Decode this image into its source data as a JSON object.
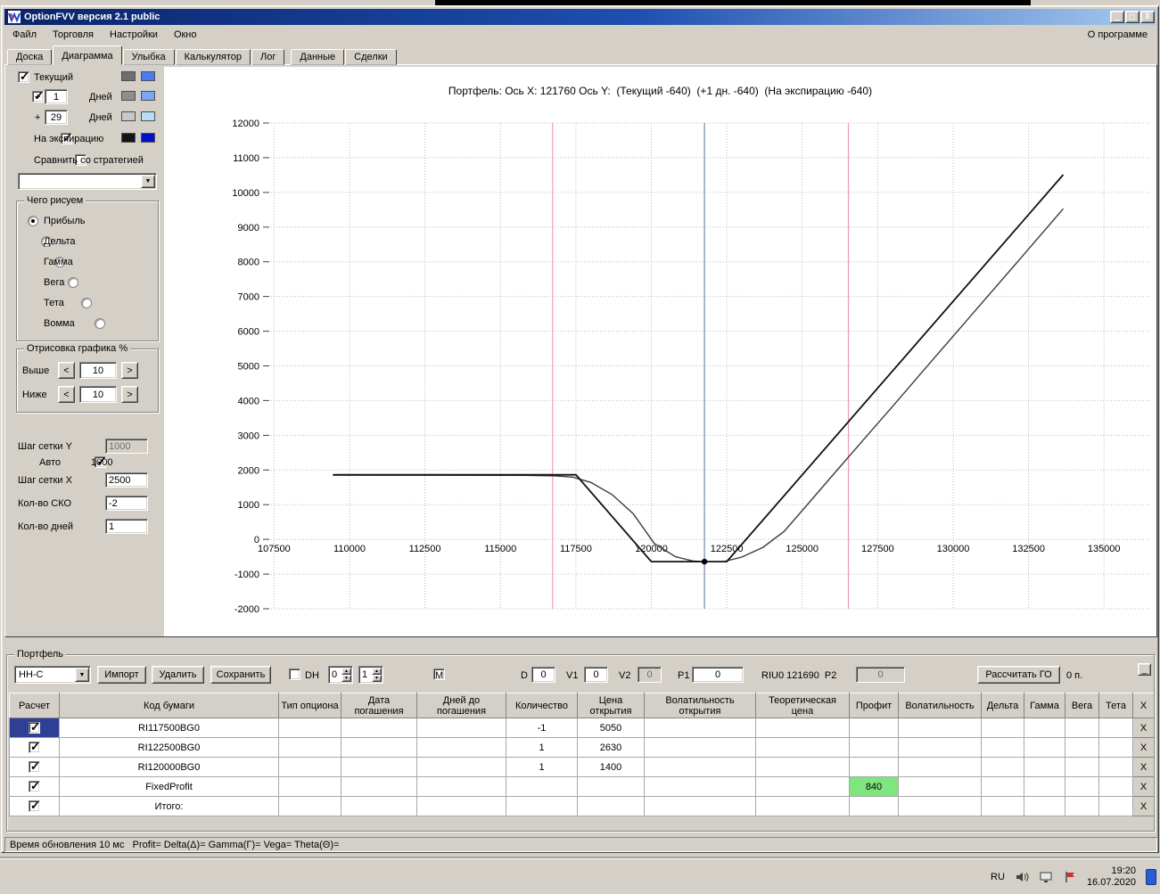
{
  "desktop": {
    "taskbar": {
      "lang": "RU",
      "time": "19:20",
      "date": "16.07.2020"
    }
  },
  "window": {
    "title": "OptionFVV версия 2.1 public",
    "controls": {
      "minimize": "_",
      "maximize": "□",
      "close": "X"
    },
    "menu": {
      "items": [
        {
          "label": "Файл"
        },
        {
          "label": "Торговля"
        },
        {
          "label": "Настройки"
        },
        {
          "label": "Окно"
        }
      ],
      "right_label": "О программе"
    },
    "tabs": [
      {
        "label": "Доска",
        "active": false
      },
      {
        "label": "Диаграмма",
        "active": true
      },
      {
        "label": "Улыбка",
        "active": false
      },
      {
        "label": "Калькулятор",
        "active": false
      },
      {
        "label": "Лог",
        "active": false
      },
      {
        "label": "Данные",
        "active": false
      },
      {
        "label": "Сделки",
        "active": false
      }
    ]
  },
  "left_panel": {
    "legend": {
      "rows": [
        {
          "label": "Текущий",
          "checked": true,
          "colors": [
            "#6e6e6e",
            "#4a7cf0"
          ]
        },
        {
          "prefix": "+",
          "days": "1",
          "suffix": "Дней",
          "checked": true,
          "colors": [
            "#8f8f8f",
            "#7aa6f4"
          ]
        },
        {
          "prefix": "+",
          "days": "29",
          "suffix": "Дней",
          "checked": false,
          "colors": [
            "#c8c8c8",
            "#b9dcf8"
          ]
        },
        {
          "label": "На экспирацию",
          "checked": true,
          "colors": [
            "#141414",
            "#0010c8"
          ]
        }
      ],
      "compare": {
        "label": "Сравнить со стратегией",
        "checked": false
      },
      "strategy_value": ""
    },
    "draw_group": {
      "title": "Чего рисуем",
      "options": [
        {
          "label": "Прибыль",
          "selected": true
        },
        {
          "label": "Дельта",
          "selected": false
        },
        {
          "label": "Гамма",
          "selected": false
        },
        {
          "label": "Вега",
          "selected": false
        },
        {
          "label": "Тета",
          "selected": false
        },
        {
          "label": "Вомма",
          "selected": false
        }
      ]
    },
    "range_group": {
      "title": "Отрисовка графика %",
      "rows": [
        {
          "label": "Выше",
          "value": "10"
        },
        {
          "label": "Ниже",
          "value": "10"
        }
      ],
      "dec_label": "<",
      "inc_label": ">"
    },
    "grid_settings": {
      "step_y_label": "Шаг сетки Y",
      "step_y_value": "1000",
      "auto_label": "Авто",
      "auto_checked": true,
      "auto_value": "1000",
      "step_x_label": "Шаг сетки X",
      "step_x_value": "2500",
      "sko_label": "Кол-во СКО",
      "sko_value": "-2",
      "days_label": "Кол-во дней",
      "days_value": "1"
    }
  },
  "chart": {
    "title": "Портфель: Ось X: 121760 Ось Y:  (Текущий -640)  (+1 дн. -640)  (На экспирацию -640)"
  },
  "chart_data": {
    "type": "line",
    "title": "Портфель: Ось X: 121760 Ось Y: (Текущий -640) (+1 дн. -640) (На экспирацию -640)",
    "xlabel": "",
    "ylabel": "",
    "xlim": [
      107400,
      136500
    ],
    "ylim": [
      -2000,
      12000
    ],
    "x_ticks": [
      107500,
      110000,
      112500,
      115000,
      117500,
      120000,
      122500,
      125000,
      127500,
      130000,
      132500,
      135000
    ],
    "y_ticks": [
      -2000,
      -1000,
      0,
      1000,
      2000,
      3000,
      4000,
      5000,
      6000,
      7000,
      8000,
      9000,
      10000,
      11000,
      12000
    ],
    "grid": true,
    "legend_position": "none",
    "series": [
      {
        "name": "Текущий",
        "color": "#3c3c3c",
        "width": 1.4,
        "points": [
          [
            109450,
            1850
          ],
          [
            115800,
            1845
          ],
          [
            116800,
            1830
          ],
          [
            117400,
            1795
          ],
          [
            118000,
            1640
          ],
          [
            118700,
            1290
          ],
          [
            119400,
            740
          ],
          [
            120100,
            -120
          ],
          [
            120800,
            -500
          ],
          [
            121400,
            -625
          ],
          [
            121760,
            -645
          ],
          [
            122400,
            -640
          ],
          [
            123000,
            -510
          ],
          [
            123700,
            -230
          ],
          [
            124400,
            230
          ],
          [
            125200,
            1030
          ],
          [
            126000,
            1840
          ],
          [
            127000,
            2840
          ],
          [
            128000,
            3840
          ],
          [
            129000,
            4850
          ],
          [
            130000,
            5855
          ],
          [
            131000,
            6860
          ],
          [
            132000,
            7865
          ],
          [
            133650,
            9530
          ]
        ]
      },
      {
        "name": "На экспирацию",
        "color": "#111111",
        "width": 1.8,
        "points": [
          [
            109450,
            1860
          ],
          [
            117500,
            1860
          ],
          [
            120000,
            -640
          ],
          [
            122500,
            -640
          ],
          [
            133650,
            10510
          ]
        ]
      }
    ],
    "vlines": [
      {
        "name": "sko-lower",
        "x": 116730,
        "color": "#f29cb4"
      },
      {
        "name": "sko-upper",
        "x": 126530,
        "color": "#f29cb4"
      },
      {
        "name": "current-price",
        "x": 121760,
        "color": "#7384b5"
      }
    ],
    "marker": {
      "x": 121760,
      "y": -640,
      "color": "#000000"
    }
  },
  "portfolio": {
    "group_title": "Портфель",
    "name_value": "НН-С",
    "import_label": "Импорт",
    "delete_label": "Удалить",
    "save_label": "Сохранить",
    "dh_label": "DH",
    "dh_checked": false,
    "dh_spin1": "0",
    "dh_spin2": "1",
    "m_label": "M",
    "m_checked": false,
    "d_label": "D",
    "d_value": "0",
    "v1_label": "V1",
    "v1_value": "0",
    "v2_label": "V2",
    "v2_value": "0",
    "p1_label": "P1",
    "p1_value": "0",
    "riu_label": "RIU0 121690  P2",
    "p2_value": "0",
    "calc_go_label": "Рассчитать ГО",
    "points_label": "0 п.",
    "collapse_label": "_",
    "table": {
      "headers": [
        "Расчет",
        "Код бумаги",
        "Тип опциона",
        "Дата погашения",
        "Дней до погашения",
        "Количество",
        "Цена открытия",
        "Волатильность открытия",
        "Теоретическая цена",
        "Профит",
        "Волатильность",
        "Дельта",
        "Гамма",
        "Вега",
        "Тета",
        "X"
      ],
      "row_delete_label": "X",
      "profit_highlight_color": "#7fe57f",
      "rows": [
        {
          "checked": true,
          "selected": true,
          "code": "RI117500BG0",
          "quantity": "-1",
          "open_price": "5050",
          "profit": "",
          "profit_hl": false
        },
        {
          "checked": true,
          "selected": false,
          "code": "RI122500BG0",
          "quantity": "1",
          "open_price": "2630",
          "profit": "",
          "profit_hl": false
        },
        {
          "checked": true,
          "selected": false,
          "code": "RI120000BG0",
          "quantity": "1",
          "open_price": "1400",
          "profit": "",
          "profit_hl": false
        },
        {
          "checked": true,
          "selected": false,
          "code": "FixedProfit",
          "quantity": "",
          "open_price": "",
          "profit": "840",
          "profit_hl": true
        },
        {
          "checked": true,
          "selected": false,
          "code": "Итого:",
          "quantity": "",
          "open_price": "",
          "profit": "",
          "profit_hl": false
        }
      ]
    }
  },
  "status_bar": {
    "text": "Время обновления 10 мс   Profit= Delta(Δ)= Gamma(Γ)= Vega= Theta(Θ)="
  }
}
